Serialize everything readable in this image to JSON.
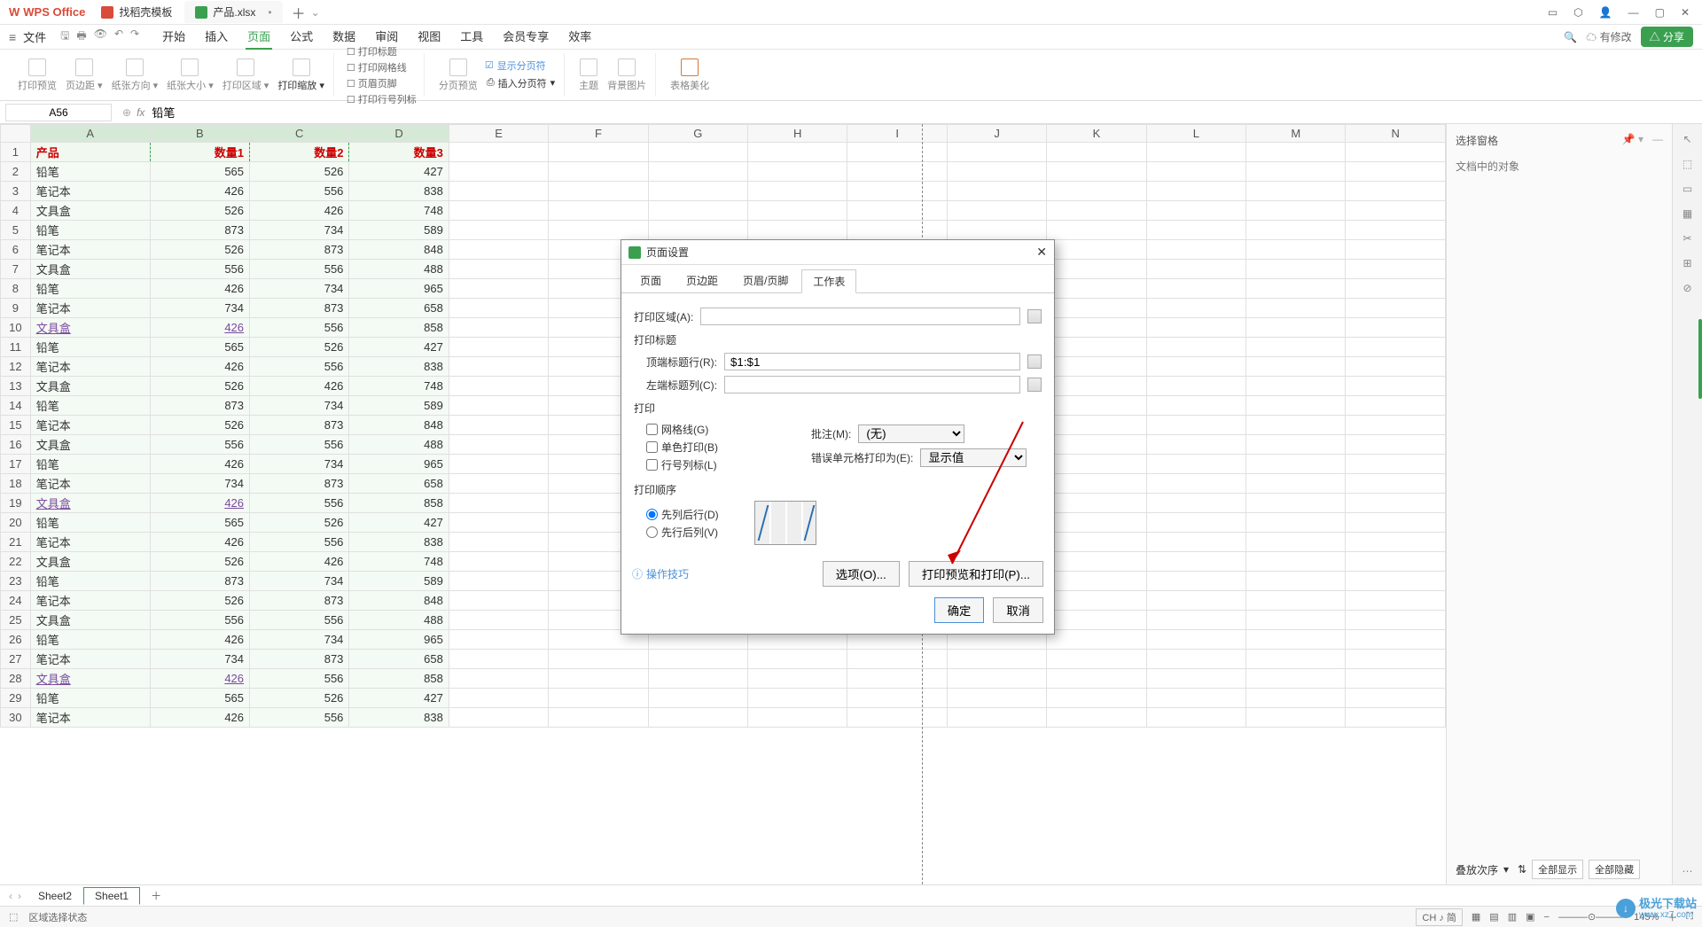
{
  "titlebar": {
    "appname": "WPS Office",
    "tabs": [
      {
        "label": "找稻壳模板",
        "icon": "template"
      },
      {
        "label": "产品.xlsx",
        "icon": "sheet",
        "active": true,
        "dirty": "•"
      }
    ]
  },
  "menubar": {
    "file": "文件",
    "tabs": [
      "开始",
      "插入",
      "页面",
      "公式",
      "数据",
      "审阅",
      "视图",
      "工具",
      "会员专享",
      "效率"
    ],
    "active": "页面",
    "status": "有修改",
    "share": "分享"
  },
  "ribbon": {
    "g1": [
      "打印预览",
      "页边距",
      "纸张方向",
      "纸张大小",
      "打印区域",
      "打印缩放"
    ],
    "g2_checks": [
      "打印标题",
      "打印网格线",
      "页眉页脚",
      "打印行号列标"
    ],
    "g3": [
      "分页预览",
      "插入分页符"
    ],
    "g3_check": "显示分页符",
    "g4": [
      "主题",
      "背景图片"
    ],
    "g5": [
      "表格美化"
    ]
  },
  "namebox": "A56",
  "formula": "铅笔",
  "columns": [
    "A",
    "B",
    "C",
    "D",
    "E",
    "F",
    "G",
    "H",
    "I",
    "J",
    "K",
    "L",
    "M",
    "N"
  ],
  "header_row": [
    "产品",
    "数量1",
    "数量2",
    "数量3"
  ],
  "data": [
    [
      "铅笔",
      565,
      526,
      427
    ],
    [
      "笔记本",
      426,
      556,
      838
    ],
    [
      "文具盒",
      526,
      426,
      748
    ],
    [
      "铅笔",
      873,
      734,
      589
    ],
    [
      "笔记本",
      526,
      873,
      848
    ],
    [
      "文具盒",
      556,
      556,
      488
    ],
    [
      "铅笔",
      426,
      734,
      965
    ],
    [
      "笔记本",
      734,
      873,
      658
    ],
    [
      "文具盒",
      426,
      556,
      858
    ],
    [
      "铅笔",
      565,
      526,
      427
    ],
    [
      "笔记本",
      426,
      556,
      838
    ],
    [
      "文具盒",
      526,
      426,
      748
    ],
    [
      "铅笔",
      873,
      734,
      589
    ],
    [
      "笔记本",
      526,
      873,
      848
    ],
    [
      "文具盒",
      556,
      556,
      488
    ],
    [
      "铅笔",
      426,
      734,
      965
    ],
    [
      "笔记本",
      734,
      873,
      658
    ],
    [
      "文具盒",
      426,
      556,
      858
    ],
    [
      "铅笔",
      565,
      526,
      427
    ],
    [
      "笔记本",
      426,
      556,
      838
    ],
    [
      "文具盒",
      526,
      426,
      748
    ],
    [
      "铅笔",
      873,
      734,
      589
    ],
    [
      "笔记本",
      526,
      873,
      848
    ],
    [
      "文具盒",
      556,
      556,
      488
    ],
    [
      "铅笔",
      426,
      734,
      965
    ],
    [
      "笔记本",
      734,
      873,
      658
    ],
    [
      "文具盒",
      426,
      556,
      858
    ],
    [
      "铅笔",
      565,
      526,
      427
    ],
    [
      "笔记本",
      426,
      556,
      838
    ]
  ],
  "link_rows": [
    10,
    19,
    28
  ],
  "rsidebar": {
    "title": "选择窗格",
    "sub": "文档中的对象",
    "order_label": "叠放次序",
    "show_all": "全部显示",
    "hide_all": "全部隐藏"
  },
  "sheets": [
    "Sheet2",
    "Sheet1"
  ],
  "active_sheet": "Sheet1",
  "statusbar": {
    "left": "区域选择状态",
    "ime": "CH ♪ 简",
    "zoom": "145%"
  },
  "dialog": {
    "title": "页面设置",
    "tabs": [
      "页面",
      "页边距",
      "页眉/页脚",
      "工作表"
    ],
    "active_tab": "工作表",
    "print_area_label": "打印区域(A):",
    "title_section": "打印标题",
    "top_row_label": "顶端标题行(R):",
    "top_row_value": "$1:$1",
    "left_col_label": "左端标题列(C):",
    "print_section": "打印",
    "checks": [
      "网格线(G)",
      "单色打印(B)",
      "行号列标(L)"
    ],
    "comments_label": "批注(M):",
    "comments_value": "(无)",
    "errors_label": "错误单元格打印为(E):",
    "errors_value": "显示值",
    "order_section": "打印顺序",
    "radio1": "先列后行(D)",
    "radio2": "先行后列(V)",
    "btn_options": "选项(O)...",
    "btn_preview": "打印预览和打印(P)...",
    "btn_ok": "确定",
    "btn_cancel": "取消",
    "tips": "操作技巧"
  },
  "watermark": {
    "site": "www.xz7.com",
    "name": "极光下载站"
  }
}
